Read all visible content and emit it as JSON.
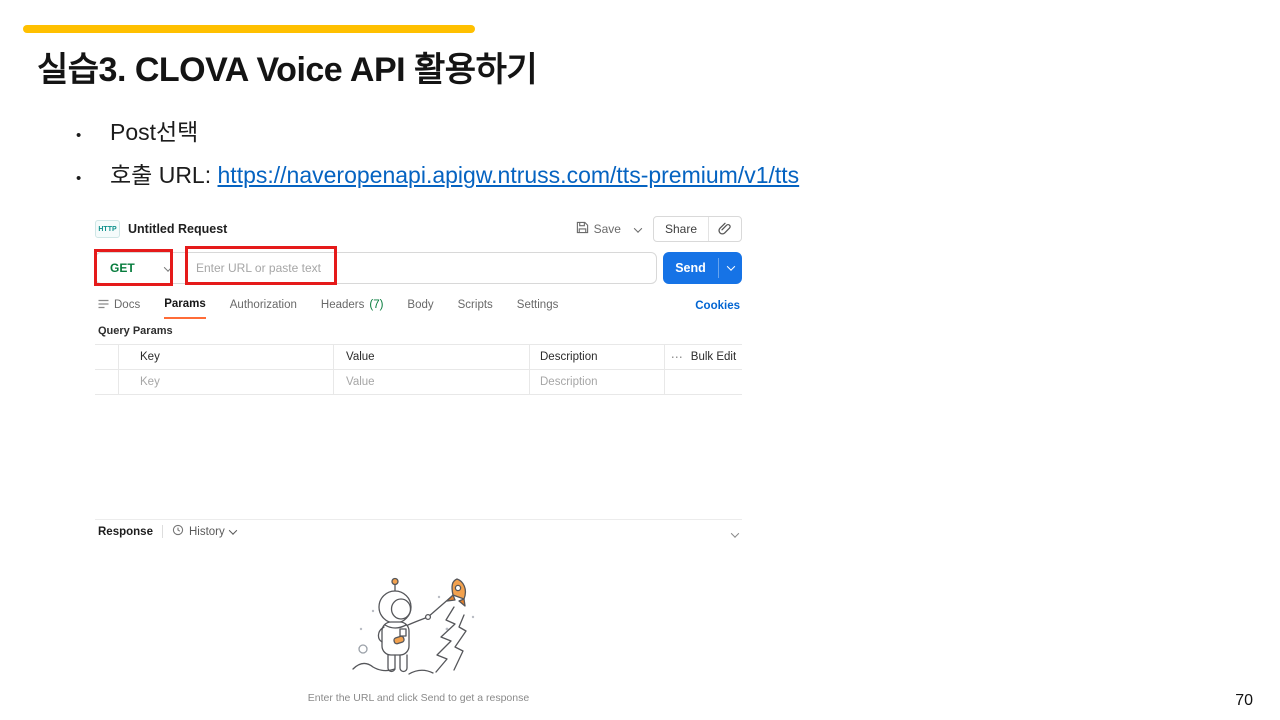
{
  "slide": {
    "title": "실습3. CLOVA Voice API 활용하기",
    "bullet1": "Post선택",
    "bullet2_prefix": "호출 URL: ",
    "bullet2_link": "https://naveropenapi.apigw.ntruss.com/tts-premium/v1/tts",
    "page_number": "70"
  },
  "postman": {
    "header": {
      "icon_label": "HTTP",
      "request_title": "Untitled Request",
      "save_label": "Save",
      "share_label": "Share"
    },
    "request_bar": {
      "method": "GET",
      "url_placeholder": "Enter URL or paste text",
      "send_label": "Send"
    },
    "tabs": [
      {
        "label": "Docs"
      },
      {
        "label": "Params"
      },
      {
        "label": "Authorization"
      },
      {
        "label": "Headers",
        "count": "(7)"
      },
      {
        "label": "Body"
      },
      {
        "label": "Scripts"
      },
      {
        "label": "Settings"
      }
    ],
    "cookies_label": "Cookies",
    "query_params": {
      "section_label": "Query Params",
      "columns": {
        "key": "Key",
        "value": "Value",
        "description": "Description"
      },
      "bulk_edit_label": "Bulk Edit",
      "dots": "⋯",
      "placeholder_row": {
        "key": "Key",
        "value": "Value",
        "description": "Description"
      }
    },
    "response": {
      "label": "Response",
      "history_label": "History",
      "empty_state_text": "Enter the URL and click Send to get a response"
    },
    "colors": {
      "accent_bar_yellow": "#FFC000",
      "hyperlink_blue": "#0563C1",
      "method_green": "#077C3D",
      "send_button_blue": "#1673E6",
      "cookies_blue": "#0265D2",
      "active_tab_underline_orange": "#FF6C37",
      "annotation_red": "#E51A1A",
      "rocket_orange": "#F2A14E"
    }
  }
}
